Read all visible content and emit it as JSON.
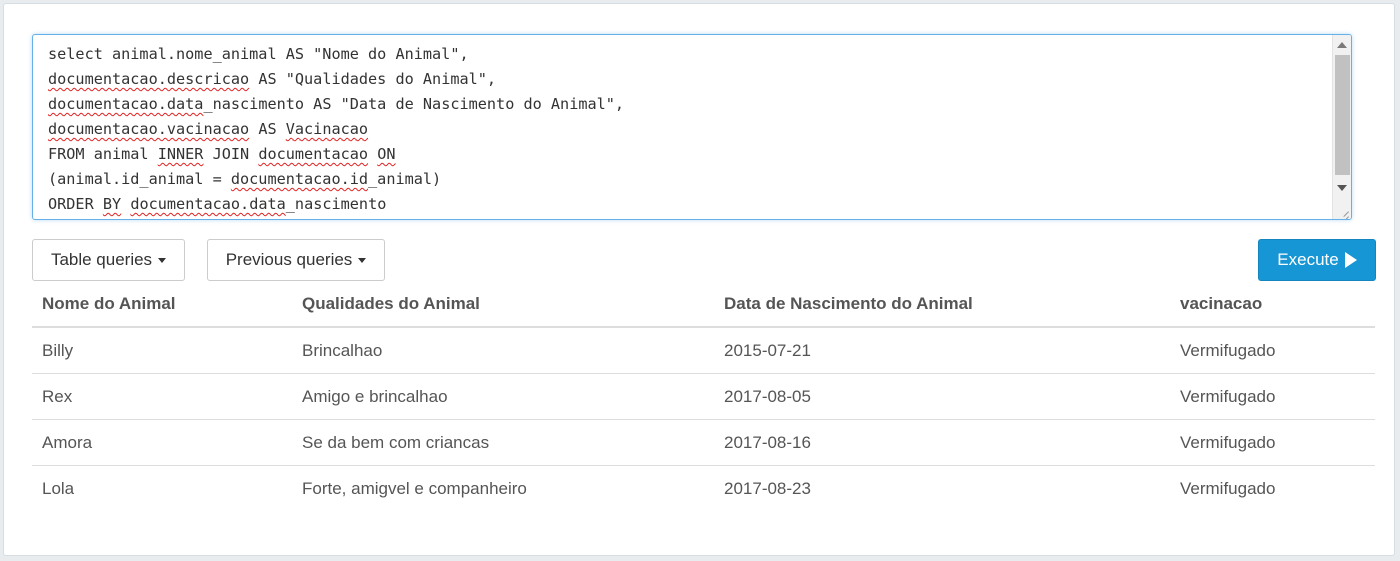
{
  "query": {
    "lines": [
      [
        {
          "t": "select animal.nome_animal AS \"Nome do Animal\","
        }
      ],
      [
        {
          "t": "documentacao.descricao",
          "sq": true
        },
        {
          "t": " AS \"Qualidades do Animal\","
        }
      ],
      [
        {
          "t": "documentacao.data",
          "sq": true
        },
        {
          "t": "_nascimento AS \"Data de Nascimento do Animal\","
        }
      ],
      [
        {
          "t": "documentacao.vacinacao",
          "sq": true
        },
        {
          "t": " AS "
        },
        {
          "t": "Vacinacao",
          "sq": true
        }
      ],
      [
        {
          "t": "FROM animal "
        },
        {
          "t": "INNER",
          "sq": true
        },
        {
          "t": " JOIN "
        },
        {
          "t": "documentacao",
          "sq": true
        },
        {
          "t": " "
        },
        {
          "t": "ON",
          "sq": true
        }
      ],
      [
        {
          "t": "(animal.id_animal = "
        },
        {
          "t": "documentacao.id",
          "sq": true
        },
        {
          "t": "_animal)"
        }
      ],
      [
        {
          "t": "ORDER "
        },
        {
          "t": "BY",
          "sq": true
        },
        {
          "t": " "
        },
        {
          "t": "documentacao.data",
          "sq": true
        },
        {
          "t": "_nascimento"
        }
      ]
    ]
  },
  "toolbar": {
    "table_queries_label": "Table queries",
    "previous_queries_label": "Previous queries",
    "execute_label": "Execute"
  },
  "results": {
    "columns": [
      "Nome do Animal",
      "Qualidades do Animal",
      "Data de Nascimento do Animal",
      "vacinacao"
    ],
    "rows": [
      [
        "Billy",
        "Brincalhao",
        "2015-07-21",
        "Vermifugado"
      ],
      [
        "Rex",
        "Amigo e brincalhao",
        "2017-08-05",
        "Vermifugado"
      ],
      [
        "Amora",
        "Se da bem com criancas",
        "2017-08-16",
        "Vermifugado"
      ],
      [
        "Lola",
        "Forte, amigvel e companheiro",
        "2017-08-23",
        "Vermifugado"
      ]
    ]
  },
  "colors": {
    "execute_bg": "#1796d5",
    "focus_border": "#66afe9",
    "spell_error": "#e02020"
  },
  "icons": {
    "dropdown": "caret-down-icon",
    "execute": "play-icon"
  }
}
